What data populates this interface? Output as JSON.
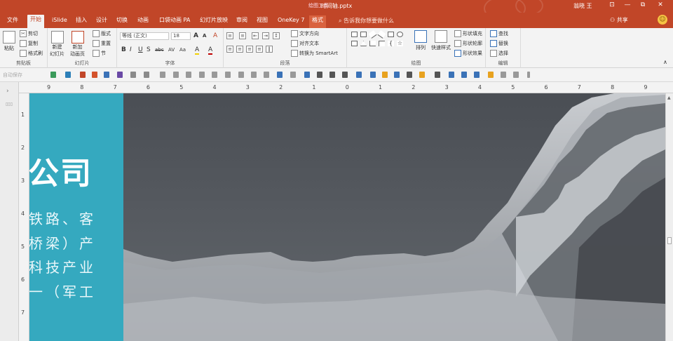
{
  "window": {
    "title": "时间轴.pptx",
    "tools_title": "绘图工具",
    "user": "翁晓 王",
    "min": "—",
    "restore": "⧉",
    "close": "✕",
    "ribbon_toggle": "⊡"
  },
  "tabs": [
    {
      "label": "文件"
    },
    {
      "label": "开始"
    },
    {
      "label": "iSlide"
    },
    {
      "label": "插入"
    },
    {
      "label": "设计"
    },
    {
      "label": "切换"
    },
    {
      "label": "动画"
    },
    {
      "label": "口袋动画 PA"
    },
    {
      "label": "幻灯片放映"
    },
    {
      "label": "审阅"
    },
    {
      "label": "视图"
    },
    {
      "label": "OneKey 7"
    },
    {
      "label": "格式"
    }
  ],
  "search": {
    "placeholder": "告诉我你想要做什么"
  },
  "share": {
    "label": "共享"
  },
  "clipboard": {
    "group": "剪贴板",
    "paste": "粘贴",
    "cut": "剪切",
    "copy": "复制",
    "format_painter": "格式刷"
  },
  "slides": {
    "group": "幻灯片",
    "new_slide": "新建",
    "new_slide2": "幻灯片",
    "new_anim": "新加",
    "new_anim2": "动画页",
    "layout": "版式",
    "reset": "重置",
    "section": "节"
  },
  "font": {
    "group": "字体",
    "name": "等线 (正文)",
    "size": "18",
    "bold": "B",
    "italic": "I",
    "underline": "U",
    "strike": "S",
    "shadow": "abc",
    "spacing": "AV",
    "case": "Aa",
    "color": "A",
    "grow": "A",
    "shrink": "A",
    "clear": "A"
  },
  "paragraph": {
    "group": "段落",
    "text_direction": "文字方向",
    "align_text": "对齐文本",
    "smartart": "转换为 SmartArt"
  },
  "drawing": {
    "group": "绘图",
    "arrange": "排列",
    "quick_styles": "快速样式",
    "fill": "形状填充",
    "outline": "形状轮廓",
    "effects": "形状效果"
  },
  "editing": {
    "group": "编辑",
    "find": "查找",
    "replace": "替换",
    "select": "选择"
  },
  "qat": {
    "autosave": "自动保存"
  },
  "ruler": {
    "h": [
      "9",
      "8",
      "7",
      "6",
      "5",
      "4",
      "3",
      "2",
      "1",
      "0",
      "1",
      "2",
      "3",
      "4",
      "5",
      "6",
      "7",
      "8",
      "9"
    ],
    "v": [
      "1",
      "2",
      "3",
      "4",
      "5",
      "6",
      "7"
    ]
  },
  "slide": {
    "heading": "公司",
    "lines": [
      "铁路、客",
      "桥梁）产",
      "科技产业",
      "一（军工"
    ]
  },
  "colors": {
    "accent": "#c14628",
    "teal": "#35a9bf"
  }
}
